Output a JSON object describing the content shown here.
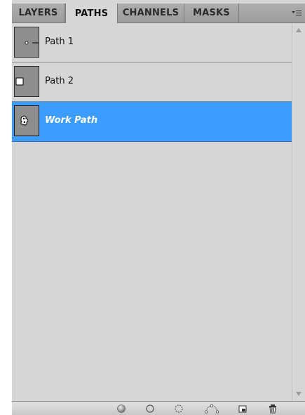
{
  "tabs": [
    {
      "label": "LAYERS"
    },
    {
      "label": "PATHS"
    },
    {
      "label": "CHANNELS"
    },
    {
      "label": "MASKS"
    }
  ],
  "paths": [
    {
      "name": "Path 1",
      "thumbnail": "open-path-dot"
    },
    {
      "name": "Path 2",
      "thumbnail": "square-path"
    },
    {
      "name": "Work Path",
      "thumbnail": "blob-path"
    }
  ],
  "selected_path_index": 2,
  "colors": {
    "panel_bg": "#d6d6d6",
    "selection": "#3c9cff",
    "thumbnail_bg": "#8e8e8e"
  },
  "footer_icons": [
    "fill-path-icon",
    "stroke-path-icon",
    "load-as-selection-icon",
    "make-work-path-icon",
    "new-path-icon",
    "delete-path-icon"
  ]
}
